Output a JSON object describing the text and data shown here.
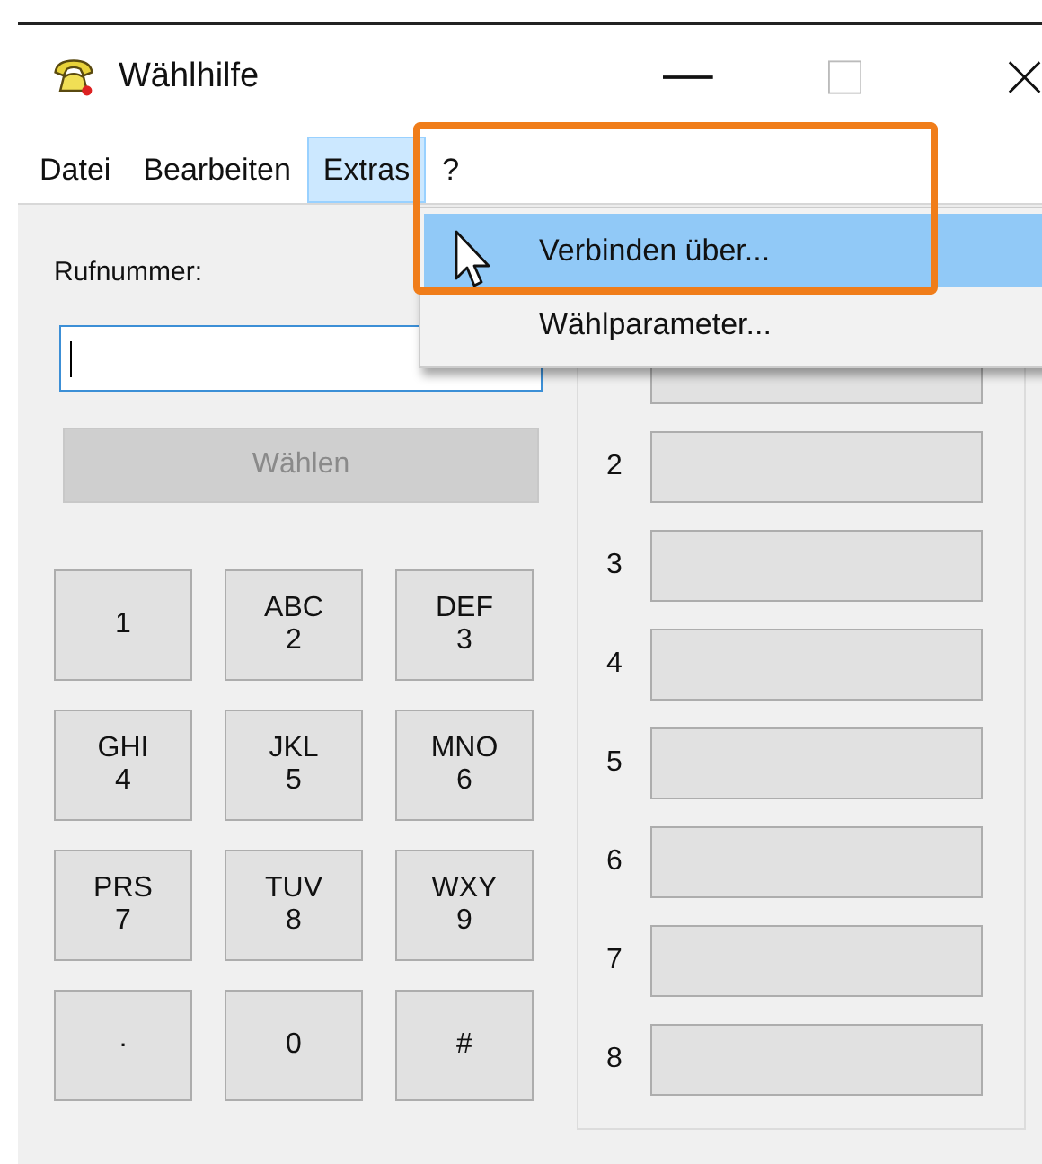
{
  "window": {
    "title": "Wählhilfe"
  },
  "menu": [
    {
      "label": "Datei",
      "selected": false
    },
    {
      "label": "Bearbeiten",
      "selected": false
    },
    {
      "label": "Extras",
      "selected": true
    },
    {
      "label": "?",
      "selected": false
    }
  ],
  "dropdown": [
    {
      "label": "Verbinden über...",
      "selected": true
    },
    {
      "label": "Wählparameter...",
      "selected": false
    }
  ],
  "number_label": "Rufnummer:",
  "dial_button": {
    "label": "Wählen",
    "disabled": true
  },
  "keypad": [
    {
      "digit": "1"
    },
    {
      "letters": "ABC",
      "digit": "2"
    },
    {
      "letters": "DEF",
      "digit": "3"
    },
    {
      "letters": "GHI",
      "digit": "4"
    },
    {
      "letters": "JKL",
      "digit": "5"
    },
    {
      "letters": "MNO",
      "digit": "6"
    },
    {
      "letters": "PRS",
      "digit": "7"
    },
    {
      "letters": "TUV",
      "digit": "8"
    },
    {
      "letters": "WXY",
      "digit": "9"
    },
    {
      "digit": "·"
    },
    {
      "digit": "0"
    },
    {
      "digit": "#"
    }
  ],
  "speed_dial": [
    {
      "label": "2"
    },
    {
      "label": "3"
    },
    {
      "label": "4"
    },
    {
      "label": "5"
    },
    {
      "label": "6"
    },
    {
      "label": "7"
    },
    {
      "label": "8"
    }
  ]
}
